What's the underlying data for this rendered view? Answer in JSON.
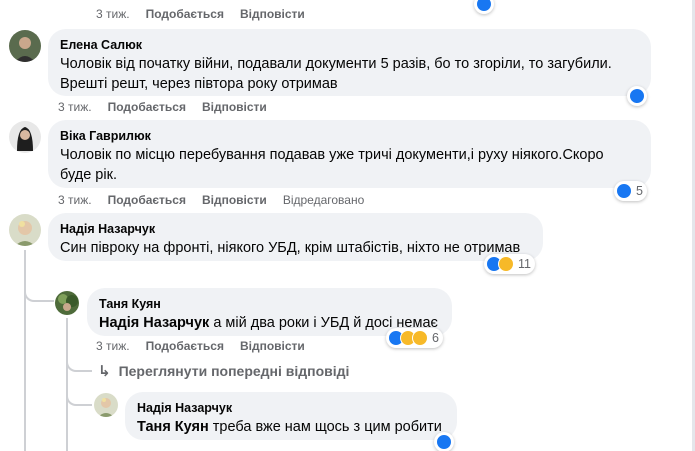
{
  "top_actions": {
    "time": "3 тиж.",
    "like": "Подобається",
    "reply": "Відповісти"
  },
  "comments": [
    {
      "author": "Елена Салюк",
      "text_line1": "Чоловік від початку війни, подавали документи 5 разів, бо то згоріли, то загубили.",
      "text_line2": "Врешті решт, через півтора року отримав",
      "time": "3 тиж.",
      "like": "Подобається",
      "reply": "Відповісти"
    },
    {
      "author": "Віка Гаврилюк",
      "text_line1": "Чоловік по місцю перебування подавав уже тричі документи,і руху ніякого.Скоро",
      "text_line2": "буде рік.",
      "time": "3 тиж.",
      "like": "Подобається",
      "reply": "Відповісти",
      "edited": "Відредаговано",
      "reactions": "5"
    },
    {
      "author": "Надія Назарчук",
      "text_line1": "Син півроку на фронті, ніякого УБД, крім штабістів, ніхто не отримав",
      "reactions": "11"
    }
  ],
  "replies": [
    {
      "author": "Таня Куян",
      "mention": "Надія Назарчук",
      "text": " а мій два роки і УБД й досі немає",
      "time": "3 тиж.",
      "like": "Подобається",
      "reply": "Відповісти",
      "reactions": "6"
    },
    {
      "author": "Надія Назарчук",
      "mention": "Таня Куян",
      "text": " треба вже нам щось з цим робити"
    }
  ],
  "view_previous": "Переглянути попередні відповіді",
  "colors": {
    "like": "#1877f2",
    "emoji": "#f7b928",
    "bubble": "#f0f2f5",
    "meta": "#65676b"
  }
}
